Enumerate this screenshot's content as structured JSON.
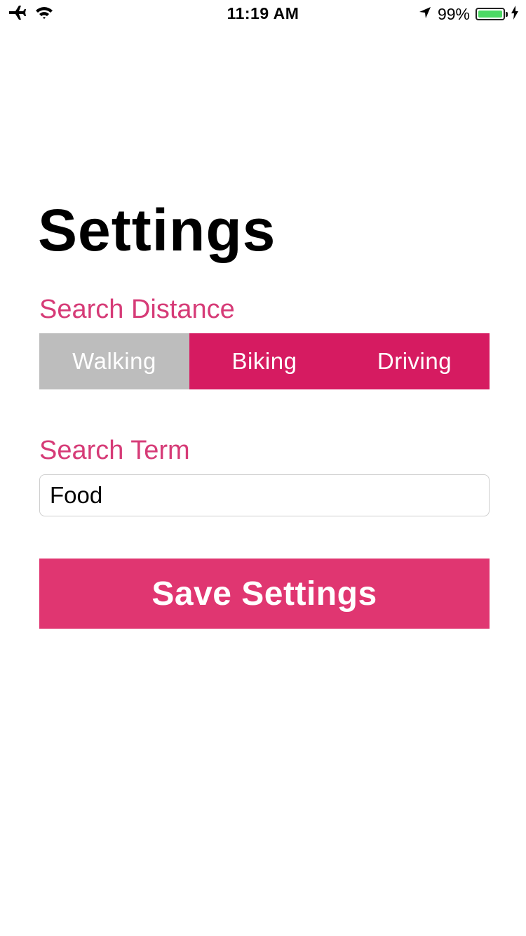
{
  "status_bar": {
    "time": "11:19 AM",
    "battery_percent": "99%",
    "battery_level": 0.99,
    "icons": [
      "airplane-icon",
      "wifi-icon",
      "location-arrow-icon",
      "battery-icon",
      "charging-bolt-icon"
    ]
  },
  "page": {
    "title": "Settings"
  },
  "search_distance": {
    "label": "Search Distance",
    "options": [
      "Walking",
      "Biking",
      "Driving"
    ],
    "selected": "Walking"
  },
  "search_term": {
    "label": "Search Term",
    "value": "Food"
  },
  "save_button": {
    "label": "Save Settings"
  },
  "colors": {
    "accent_label": "#d63b77",
    "segment_selected": "#bdbdbd",
    "segment_unselected": "#d61b61",
    "save_button": "#e03671",
    "battery_fill": "#4cd964"
  }
}
